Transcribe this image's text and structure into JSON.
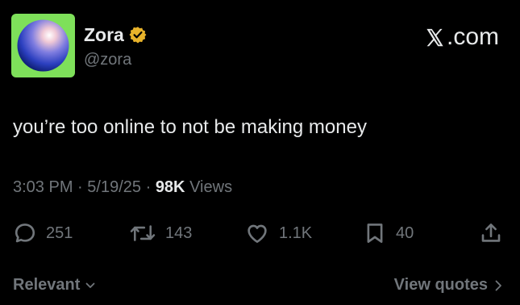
{
  "author": {
    "display_name": "Zora",
    "handle": "@zora",
    "avatar_icon": "sphere-avatar",
    "avatar_bg": "#7ee05a",
    "verified_color": "#e8b32a"
  },
  "brand": {
    "label": ".com",
    "icon": "x-logo-icon"
  },
  "tweet": {
    "text": "you’re too online to not be making money",
    "time": "3:03 PM",
    "date": "5/19/25",
    "separator": "·",
    "views_count": "98K",
    "views_label": "Views"
  },
  "actions": {
    "replies": "251",
    "reposts": "143",
    "likes": "1.1K",
    "bookmarks": "40"
  },
  "footer": {
    "sort_label": "Relevant",
    "view_quotes_label": "View quotes"
  },
  "colors": {
    "background": "#000000",
    "primary_text": "#e7e9ea",
    "secondary_text": "#71767b"
  }
}
